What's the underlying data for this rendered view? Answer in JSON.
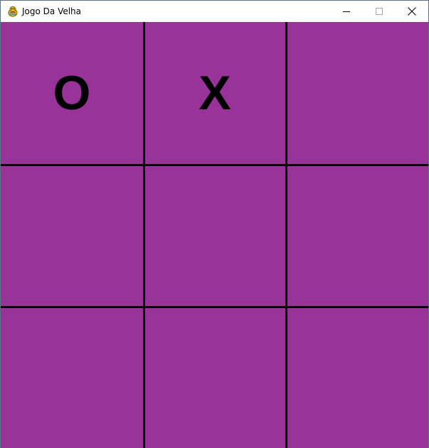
{
  "window": {
    "title": "Jogo Da Velha"
  },
  "titlebar": {
    "icons": {
      "app": "pygame-snake-icon",
      "minimize": "minimize-icon",
      "maximize": "maximize-icon",
      "close": "close-icon"
    }
  },
  "board": {
    "background_color": "#993399",
    "line_color": "#000000",
    "cells": [
      [
        "O",
        "X",
        ""
      ],
      [
        "",
        "",
        ""
      ],
      [
        "",
        "",
        ""
      ]
    ]
  }
}
